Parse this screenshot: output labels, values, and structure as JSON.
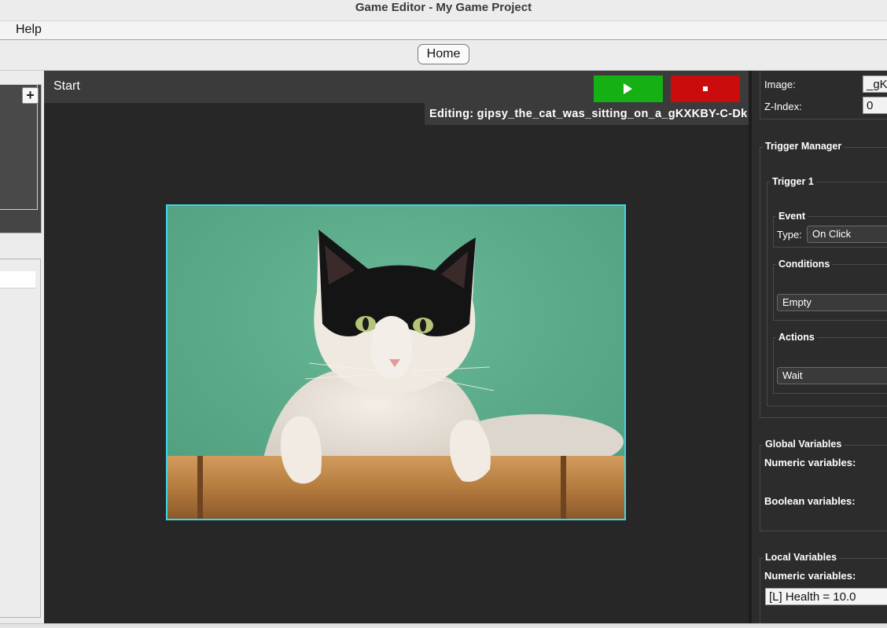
{
  "window": {
    "title": "Game Editor - My Game Project"
  },
  "menu": {
    "help": "Help"
  },
  "tabs": {
    "home": "Home"
  },
  "left_panel": {
    "add_label": "+"
  },
  "canvas": {
    "scene_title": "Start",
    "editing_label": "Editing: gipsy_the_cat_was_sitting_on_a_gKXKBY-C-Dk",
    "sprite": {
      "description": "cat-image"
    }
  },
  "properties": {
    "image_label": "Image:",
    "image_value": "_gKX",
    "zindex_label": "Z-Index:",
    "zindex_value": "0"
  },
  "triggers": {
    "manager_title": "Trigger Manager",
    "trigger_title": "Trigger 1",
    "event_title": "Event",
    "type_label": "Type:",
    "type_value": "On Click",
    "conditions_title": "Conditions",
    "condition_value": "Empty",
    "actions_title": "Actions",
    "action_value": "Wait"
  },
  "global_vars": {
    "title": "Global Variables",
    "numeric_label": "Numeric variables:",
    "boolean_label": "Boolean variables:"
  },
  "local_vars": {
    "title": "Local Variables",
    "numeric_label": "Numeric variables:",
    "health": "[L] Health = 10.0"
  },
  "colors": {
    "play": "#14b014",
    "stop": "#cb0c0c",
    "canvas_bg": "#272727",
    "selection_outline": "#3fd6e4"
  }
}
